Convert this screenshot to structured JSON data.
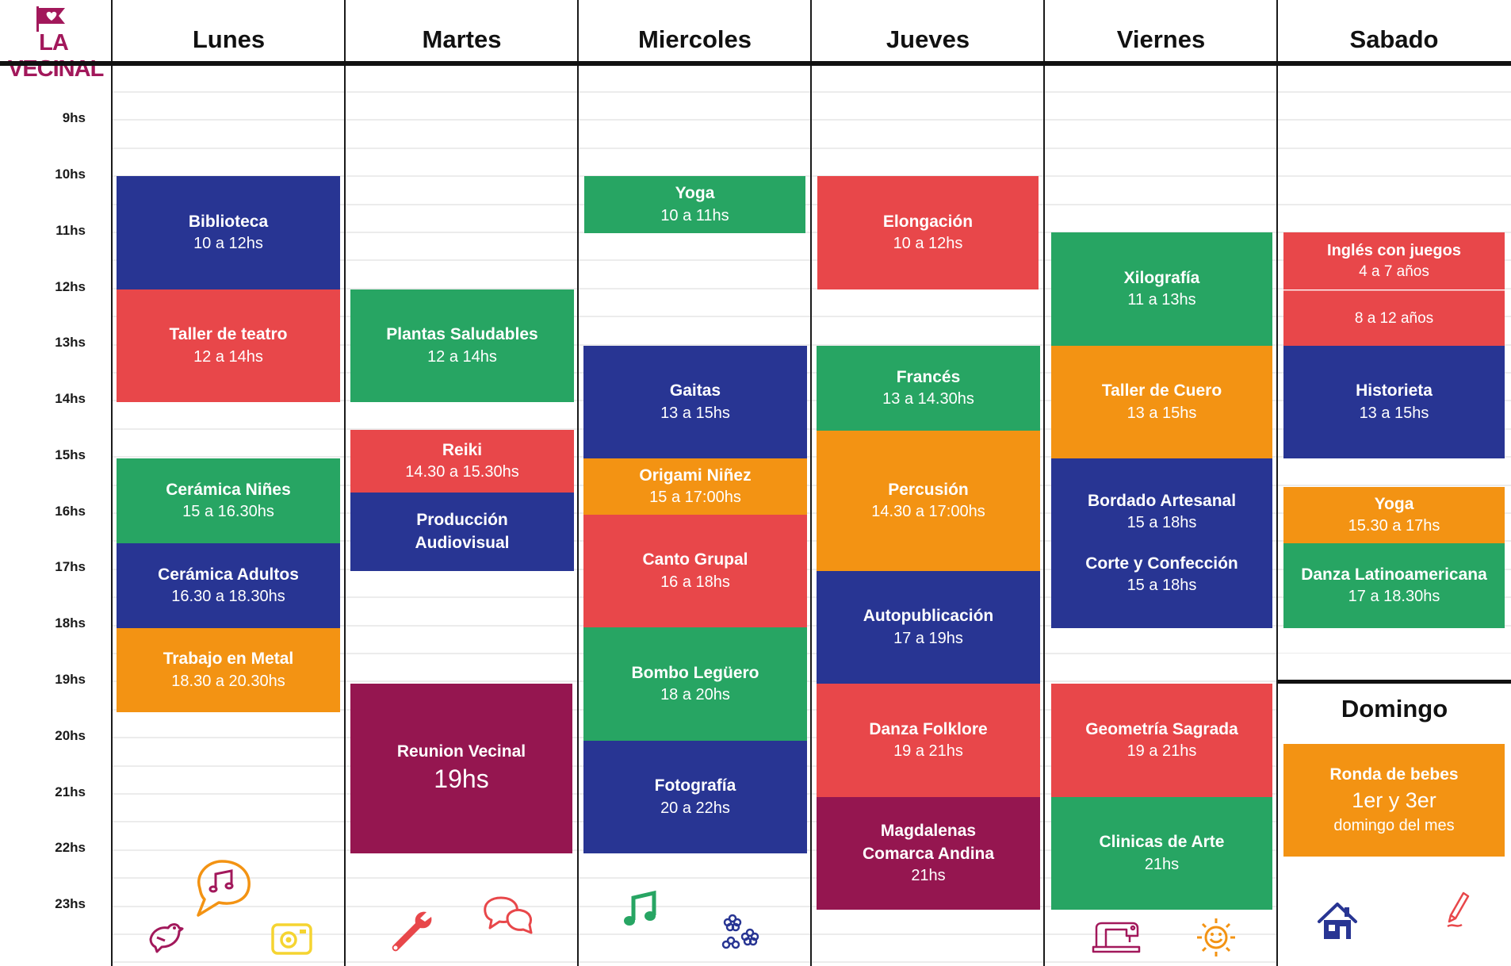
{
  "brand": {
    "name": "LA VECINAL"
  },
  "days": [
    "Lunes",
    "Martes",
    "Miercoles",
    "Jueves",
    "Viernes",
    "Sabado"
  ],
  "hours": [
    "9hs",
    "10hs",
    "11hs",
    "12hs",
    "13hs",
    "14hs",
    "15hs",
    "16hs",
    "17hs",
    "18hs",
    "19hs",
    "20hs",
    "21hs",
    "22hs",
    "23hs"
  ],
  "domingo": {
    "title": "Domingo"
  },
  "colors": {
    "blue": "#283593",
    "red": "#e8474a",
    "green": "#27a563",
    "orange": "#f39313",
    "purple": "#951650"
  },
  "activities": {
    "lunes": [
      {
        "title": "Biblioteca",
        "time": "10 a 12hs"
      },
      {
        "title": "Taller de teatro",
        "time": "12 a 14hs"
      },
      {
        "title": "Cerámica Niñes",
        "time": "15 a 16.30hs"
      },
      {
        "title": "Cerámica Adultos",
        "time": "16.30 a 18.30hs"
      },
      {
        "title": "Trabajo en Metal",
        "time": "18.30 a 20.30hs"
      }
    ],
    "martes": [
      {
        "title": "Plantas Saludables",
        "time": "12 a 14hs"
      },
      {
        "title": "Reiki",
        "time": "14.30 a 15.30hs"
      },
      {
        "title": "Producción",
        "title2": "Audiovisual"
      },
      {
        "title": "Reunion Vecinal",
        "time": "19hs"
      }
    ],
    "miercoles": [
      {
        "title": "Yoga",
        "time": "10 a 11hs"
      },
      {
        "title": "Gaitas",
        "time": "13 a 15hs"
      },
      {
        "title": "Origami Niñez",
        "time": "15 a 17:00hs"
      },
      {
        "title": "Canto Grupal",
        "time": "16 a 18hs"
      },
      {
        "title": "Bombo Legüero",
        "time": "18 a 20hs"
      },
      {
        "title": "Fotografía",
        "time": "20 a 22hs"
      }
    ],
    "jueves": [
      {
        "title": "Elongación",
        "time": "10 a 12hs"
      },
      {
        "title": "Francés",
        "time": "13 a 14.30hs"
      },
      {
        "title": "Percusión",
        "time": "14.30 a 17:00hs"
      },
      {
        "title": "Autopublicación",
        "time": "17 a 19hs"
      },
      {
        "title": "Danza Folklore",
        "time": "19 a 21hs"
      },
      {
        "title": "Magdalenas",
        "title2": "Comarca Andina",
        "time": "21hs"
      }
    ],
    "viernes": [
      {
        "title": "Xilografía",
        "time": "11 a 13hs"
      },
      {
        "title": "Taller de Cuero",
        "time": "13 a 15hs"
      },
      {
        "title": "Bordado Artesanal",
        "time": "15 a 18hs"
      },
      {
        "title": "Corte y Confección",
        "time": "15 a 18hs"
      },
      {
        "title": "Geometría Sagrada",
        "time": "19 a 21hs"
      },
      {
        "title": "Clinicas de Arte",
        "time": "21hs"
      }
    ],
    "sabado": [
      {
        "title": "Inglés con juegos",
        "time": "4 a 7 años"
      },
      {
        "time": "8 a 12 años"
      },
      {
        "title": "Historieta",
        "time": "13 a 15hs"
      },
      {
        "title": "Yoga",
        "time": "15.30 a 17hs"
      },
      {
        "title": "Danza Latinoamericana",
        "time": "17 a 18.30hs"
      }
    ],
    "domingo": [
      {
        "title": "Ronda de bebes",
        "line2": "1er y 3er",
        "line3": "domingo del mes"
      }
    ]
  },
  "icons": [
    "bird-icon",
    "music-bubble-icon",
    "camera-icon",
    "wrench-icon",
    "chat-bubbles-icon",
    "music-note-icon",
    "flowers-icon",
    "sewing-machine-icon",
    "sun-icon",
    "house-icon",
    "pencil-icon"
  ]
}
